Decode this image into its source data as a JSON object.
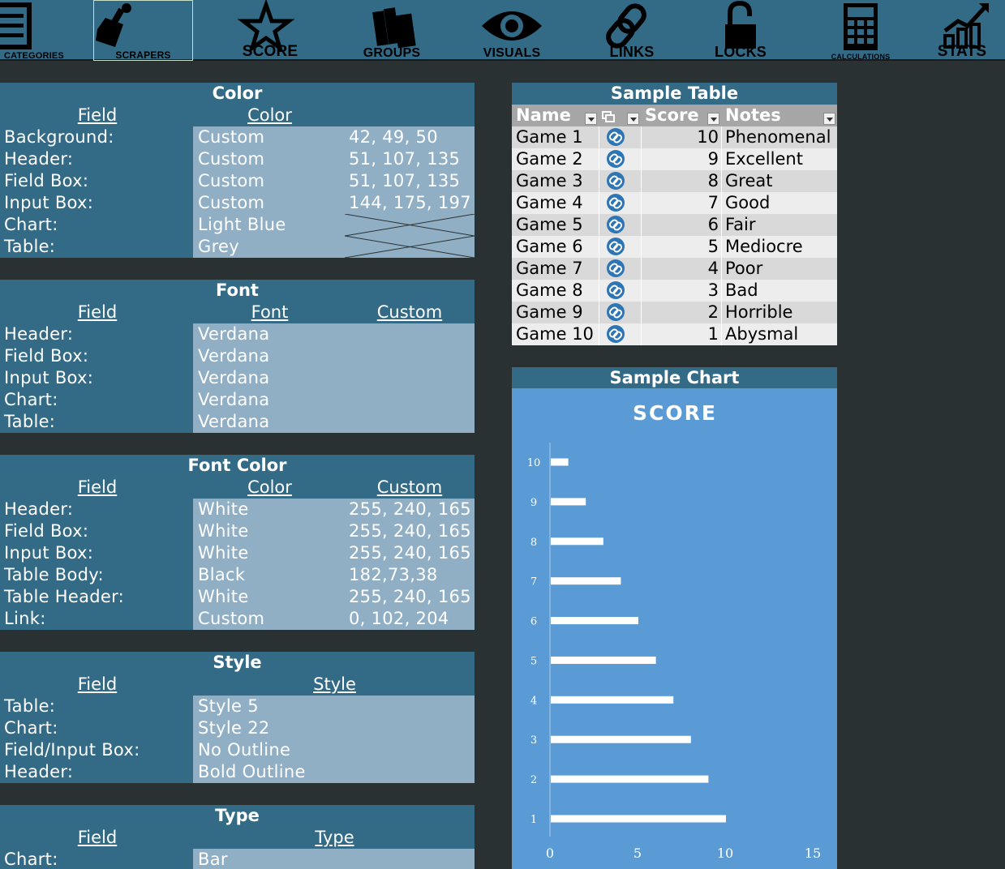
{
  "toolbar": {
    "items": [
      {
        "label": "CATEGORIES",
        "icon": "list-icon"
      },
      {
        "label": "SCRAPERS",
        "icon": "scraper-icon"
      },
      {
        "label": "SCORE",
        "icon": "star-icon"
      },
      {
        "label": "GROUPS",
        "icon": "books-icon"
      },
      {
        "label": "VISUALS",
        "icon": "eye-icon"
      },
      {
        "label": "LINKS",
        "icon": "chain-link-icon"
      },
      {
        "label": "LOCKS",
        "icon": "padlock-icon"
      },
      {
        "label": "CALCULATIONS",
        "icon": "calculator-icon"
      },
      {
        "label": "STATS",
        "icon": "stats-icon"
      }
    ]
  },
  "color_panel": {
    "title": "Color",
    "col_field": "Field",
    "col_color": "Color",
    "rows": [
      {
        "label": "Background:",
        "value": "Custom",
        "custom": "42, 49, 50"
      },
      {
        "label": "Header:",
        "value": "Custom",
        "custom": "51, 107, 135"
      },
      {
        "label": "Field Box:",
        "value": "Custom",
        "custom": "51, 107, 135"
      },
      {
        "label": "Input Box:",
        "value": "Custom",
        "custom": "144, 175, 197"
      },
      {
        "label": "Chart:",
        "value": "Light Blue",
        "custom": ""
      },
      {
        "label": "Table:",
        "value": "Grey",
        "custom": ""
      }
    ]
  },
  "font_panel": {
    "title": "Font",
    "col_field": "Field",
    "col_font": "Font",
    "col_custom": "Custom",
    "rows": [
      {
        "label": "Header:",
        "value": "Verdana"
      },
      {
        "label": "Field Box:",
        "value": "Verdana"
      },
      {
        "label": "Input Box:",
        "value": "Verdana"
      },
      {
        "label": "Chart:",
        "value": "Verdana"
      },
      {
        "label": "Table:",
        "value": "Verdana"
      }
    ]
  },
  "font_color_panel": {
    "title": "Font Color",
    "col_field": "Field",
    "col_color": "Color",
    "col_custom": "Custom",
    "rows": [
      {
        "label": "Header:",
        "value": "White",
        "custom": "255, 240, 165"
      },
      {
        "label": "Field Box:",
        "value": "White",
        "custom": "255, 240, 165"
      },
      {
        "label": "Input Box:",
        "value": "White",
        "custom": "255, 240, 165"
      },
      {
        "label": "Table Body:",
        "value": "Black",
        "custom": "182,73,38"
      },
      {
        "label": "Table Header:",
        "value": "White",
        "custom": "255, 240, 165"
      },
      {
        "label": "Link:",
        "value": "Custom",
        "custom": "0, 102, 204"
      }
    ]
  },
  "style_panel": {
    "title": "Style",
    "col_field": "Field",
    "col_style": "Style",
    "rows": [
      {
        "label": "Table:",
        "value": "Style 5"
      },
      {
        "label": "Chart:",
        "value": "Style 22"
      },
      {
        "label": "Field/Input Box:",
        "value": "No Outline"
      },
      {
        "label": "Header:",
        "value": "Bold Outline"
      }
    ]
  },
  "type_panel": {
    "title": "Type",
    "col_field": "Field",
    "col_type": "Type",
    "rows": [
      {
        "label": "Chart:",
        "value": "Bar"
      }
    ]
  },
  "sample_table": {
    "title": "Sample Table",
    "headers": {
      "name": "Name",
      "score": "Score",
      "notes": "Notes"
    },
    "link_icon": "link-icon",
    "rows": [
      {
        "name": "Game 1",
        "score": "10",
        "notes": "Phenomenal"
      },
      {
        "name": "Game 2",
        "score": "9",
        "notes": "Excellent"
      },
      {
        "name": "Game 3",
        "score": "8",
        "notes": "Great"
      },
      {
        "name": "Game 4",
        "score": "7",
        "notes": "Good"
      },
      {
        "name": "Game 5",
        "score": "6",
        "notes": "Fair"
      },
      {
        "name": "Game 6",
        "score": "5",
        "notes": "Mediocre"
      },
      {
        "name": "Game 7",
        "score": "4",
        "notes": "Poor"
      },
      {
        "name": "Game 8",
        "score": "3",
        "notes": "Bad"
      },
      {
        "name": "Game 9",
        "score": "2",
        "notes": "Horrible"
      },
      {
        "name": "Game 10",
        "score": "1",
        "notes": "Abysmal"
      }
    ]
  },
  "sample_chart": {
    "title": "Sample Chart"
  },
  "colors": {
    "background": "#2a3132",
    "header": "#336b87",
    "input_box": "#90afc5",
    "chart_bg": "#5b9bd5",
    "table_odd": "#d9d9d9",
    "table_even": "#ededed",
    "link": "#0066cc"
  },
  "chart_data": {
    "type": "bar",
    "orientation": "horizontal",
    "title": "SCORE",
    "categories": [
      "10",
      "9",
      "8",
      "7",
      "6",
      "5",
      "4",
      "3",
      "2",
      "1"
    ],
    "values": [
      1,
      2,
      3,
      4,
      5,
      6,
      7,
      8,
      9,
      10
    ],
    "xlim": [
      0,
      15
    ],
    "xticks": [
      0,
      5,
      10,
      15
    ],
    "grid": false,
    "legend": "none"
  }
}
